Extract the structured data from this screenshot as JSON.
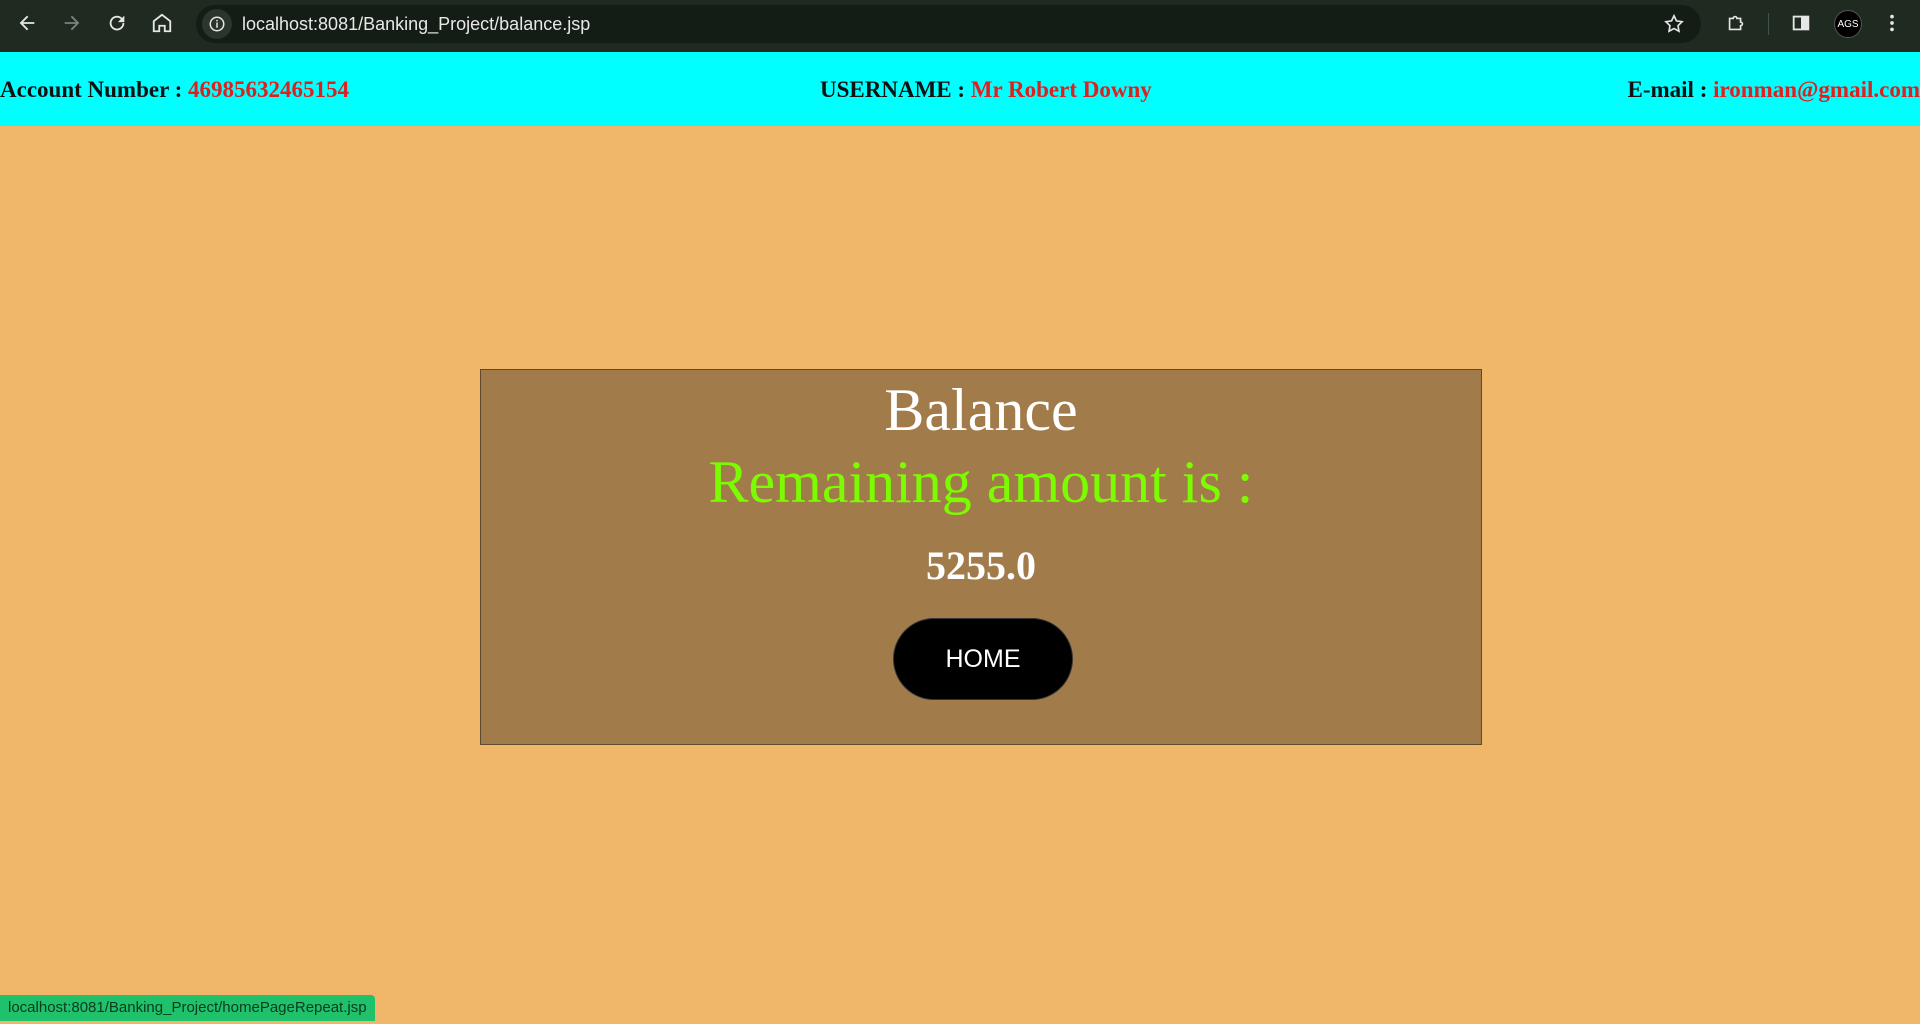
{
  "browser": {
    "url": "localhost:8081/Banking_Project/balance.jsp",
    "avatar_text": "AGS",
    "status_url": "localhost:8081/Banking_Project/homePageRepeat.jsp"
  },
  "header": {
    "account_label": "Account Number : ",
    "account_value": "46985632465154",
    "username_label": "USERNAME : ",
    "username_value": "Mr Robert Downy",
    "email_label": "E-mail : ",
    "email_value": "ironman@gmail.com"
  },
  "panel": {
    "title": "Balance",
    "subtitle": "Remaining amount is :",
    "amount": "5255.0",
    "home_label": "HOME"
  },
  "colors": {
    "page_bg": "#f0b669",
    "header_bg": "#00ffff",
    "panel_bg": "#a27b4a",
    "value_red": "#e0201e",
    "subtitle_green": "#7cfc00"
  }
}
